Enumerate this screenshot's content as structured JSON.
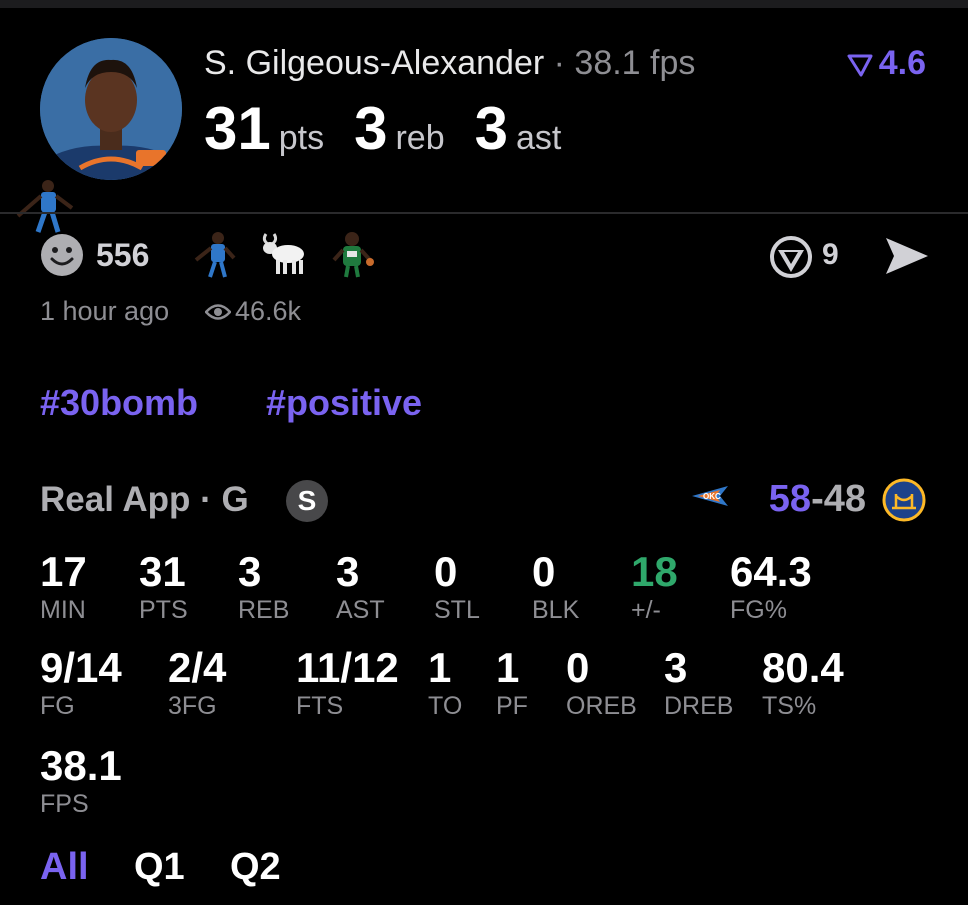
{
  "header": {
    "player_name": "S. Gilgeous-Alexander",
    "separator": "·",
    "fps_text": "38.1 fps",
    "delta_value": "4.6",
    "pts": "31",
    "pts_label": "pts",
    "reb": "3",
    "reb_label": "reb",
    "ast": "3",
    "ast_label": "ast"
  },
  "reactions": {
    "count": "556",
    "icons": [
      "smile-reaction-icon",
      "player-sticker-icon",
      "goat-icon",
      "celtics-player-sticker-icon"
    ],
    "time_ago": "1 hour ago",
    "views": "46.6k",
    "vote_count": "9"
  },
  "tags": [
    "#30bomb",
    "#positive"
  ],
  "game": {
    "source": "Real App · G",
    "badge": "S",
    "home_score": "58",
    "score_sep": "-",
    "away_score": "48",
    "accent_color": "#7a63f0"
  },
  "stats_row1": [
    {
      "value": "17",
      "label": "MIN"
    },
    {
      "value": "31",
      "label": "PTS"
    },
    {
      "value": "3",
      "label": "REB"
    },
    {
      "value": "3",
      "label": "AST"
    },
    {
      "value": "0",
      "label": "STL"
    },
    {
      "value": "0",
      "label": "BLK"
    },
    {
      "value": "18",
      "label": "+/-"
    },
    {
      "value": "64.3",
      "label": "FG%"
    }
  ],
  "stats_row2": [
    {
      "value": "9/14",
      "label": "FG"
    },
    {
      "value": "2/4",
      "label": "3FG"
    },
    {
      "value": "11/12",
      "label": "FTS"
    },
    {
      "value": "1",
      "label": "TO"
    },
    {
      "value": "1",
      "label": "PF"
    },
    {
      "value": "0",
      "label": "OREB"
    },
    {
      "value": "3",
      "label": "DREB"
    },
    {
      "value": "80.4",
      "label": "TS%"
    }
  ],
  "stats_row3": [
    {
      "value": "38.1",
      "label": "FPS"
    }
  ],
  "quarter_tabs": [
    "All",
    "Q1",
    "Q2"
  ]
}
